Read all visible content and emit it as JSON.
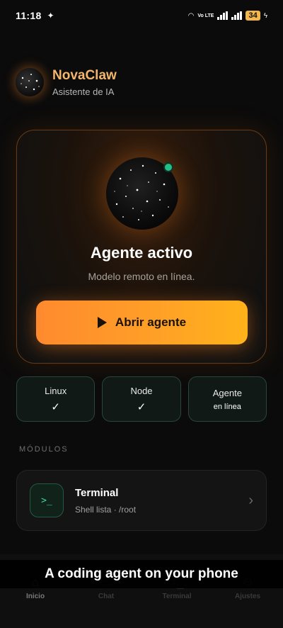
{
  "status_bar": {
    "time": "11:18",
    "network": "Vo LTE",
    "battery": "34"
  },
  "header": {
    "title": "NovaClaw",
    "subtitle": "Asistente de IA"
  },
  "hero": {
    "title": "Agente activo",
    "subtitle": "Modelo remoto en línea.",
    "button_label": "Abrir agente"
  },
  "status_tiles": [
    {
      "label": "Linux",
      "value": "✓"
    },
    {
      "label": "Node",
      "value": "✓"
    },
    {
      "label": "Agente",
      "value": "en línea"
    }
  ],
  "modules": {
    "section_label": "MÓDULOS",
    "items": [
      {
        "title": "Terminal",
        "subtitle": "Shell lista · /root",
        "icon": "terminal-icon"
      }
    ]
  },
  "bottom_nav": {
    "items": [
      {
        "label": "Inicio",
        "icon": "home-icon",
        "active": true
      },
      {
        "label": "Chat",
        "icon": "chat-icon",
        "active": false
      },
      {
        "label": "Terminal",
        "icon": "terminal-icon",
        "active": false
      },
      {
        "label": "Ajustes",
        "icon": "gear-icon",
        "active": false
      }
    ]
  },
  "caption": "A coding agent on your phone",
  "colors": {
    "accent": "#ff8a2e",
    "brand_title": "#f3b66a",
    "online": "#22c088"
  }
}
